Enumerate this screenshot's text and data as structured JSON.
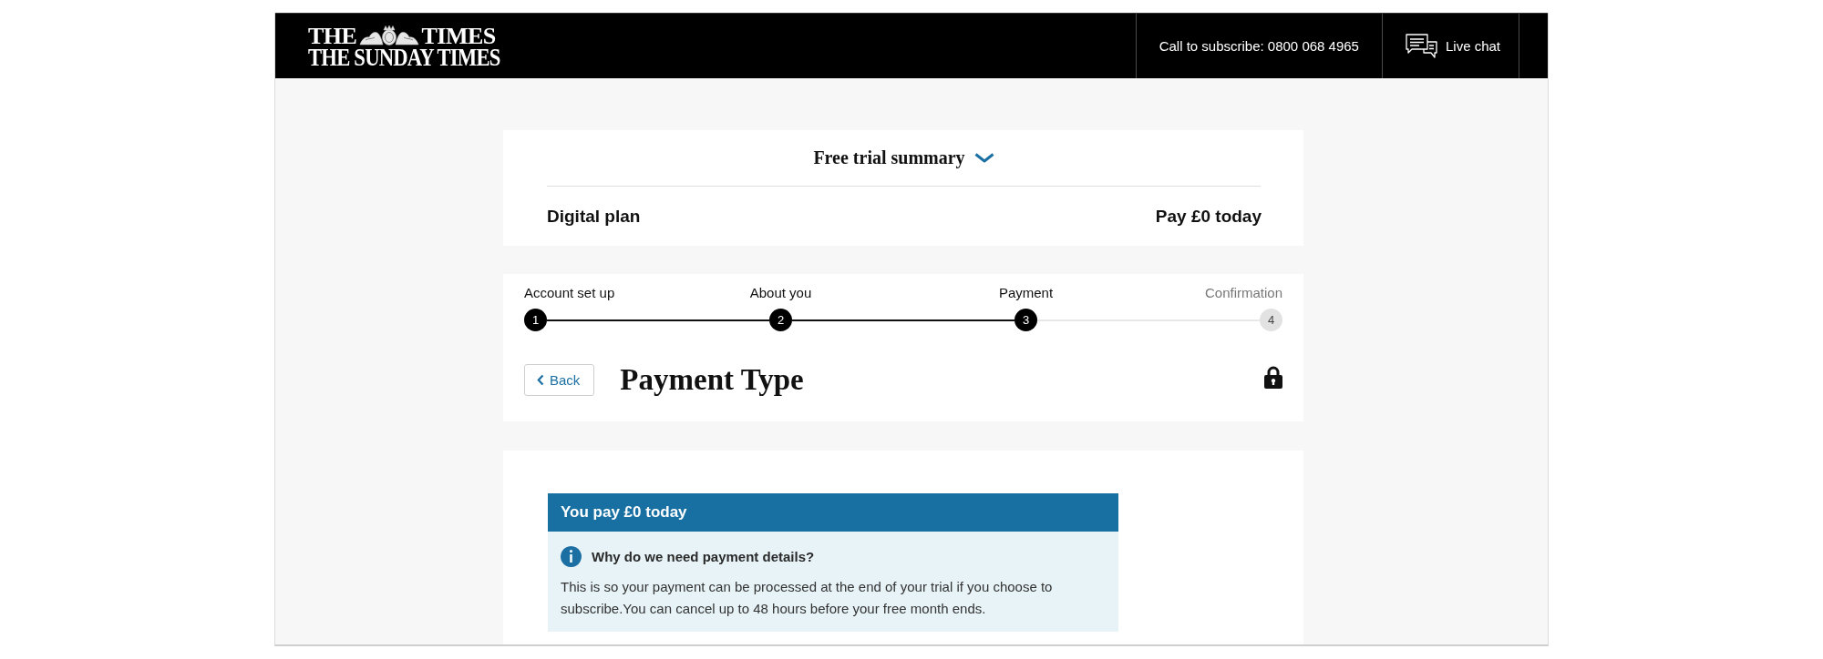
{
  "header": {
    "masthead": {
      "top_left": "THE",
      "top_right": "TIMES",
      "bottom": "THE SUNDAY TIMES"
    },
    "phone": "Call to subscribe: 0800 068 4965",
    "live_chat": "Live chat"
  },
  "summary": {
    "title": "Free trial summary",
    "expanded": false,
    "plan": "Digital plan",
    "price": "Pay £0 today"
  },
  "steps": [
    {
      "label": "Account set up",
      "number": "1",
      "active": true
    },
    {
      "label": "About you",
      "number": "2",
      "active": true
    },
    {
      "label": "Payment",
      "number": "3",
      "active": true
    },
    {
      "label": "Confirmation",
      "number": "4",
      "active": false
    }
  ],
  "page": {
    "back": "Back",
    "title": "Payment Type"
  },
  "notice": {
    "header": "You pay £0 today",
    "question": "Why do we need payment details?",
    "body": "This is so your payment can be processed at the end of your trial if you choose to subscribe.You can cancel up to 48 hours before your free month ends."
  }
}
